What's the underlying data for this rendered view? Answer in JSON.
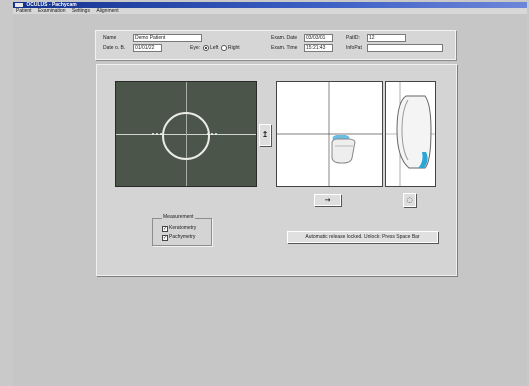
{
  "window": {
    "title": "OCULUS - Pachycam"
  },
  "menu": {
    "items": [
      "Patient",
      "Examination",
      "Settings",
      "Alignment"
    ]
  },
  "patient": {
    "name_label": "Name",
    "name_value": "Demo Patient",
    "dob_label": "Date o. B.",
    "dob_value": "01/01/22",
    "eye_label": "Eye:",
    "eye_options": [
      "Left",
      "Right"
    ],
    "eye_selected": "Left",
    "exam_date_label": "Exam. Date",
    "exam_date_value": "03/03/01",
    "exam_time_label": "Exam. Time",
    "exam_time_value": "15:21:43",
    "patid_label": "PatID:",
    "patid_value": "12",
    "info_label": "InfoPat"
  },
  "controls": {
    "up_arrow": "↥",
    "right_arrow": "→",
    "small_icon": "◌",
    "status_button": "Automatic release locked. Unlock: Press Space Bar"
  },
  "measurement": {
    "title": "Measurement",
    "keratometry_label": "Keratometry",
    "keratometry_checked": true,
    "pachymetry_label": "Pachymetry",
    "pachymetry_checked": true
  },
  "icons": {
    "app": "app-icon",
    "up": "arrow-up-icon",
    "right": "arrow-right-icon",
    "small": "settings-icon"
  },
  "colors": {
    "titlebar": "#14328f",
    "camera_bg": "#4b5549",
    "accent_blue": "#2aa7d6"
  }
}
